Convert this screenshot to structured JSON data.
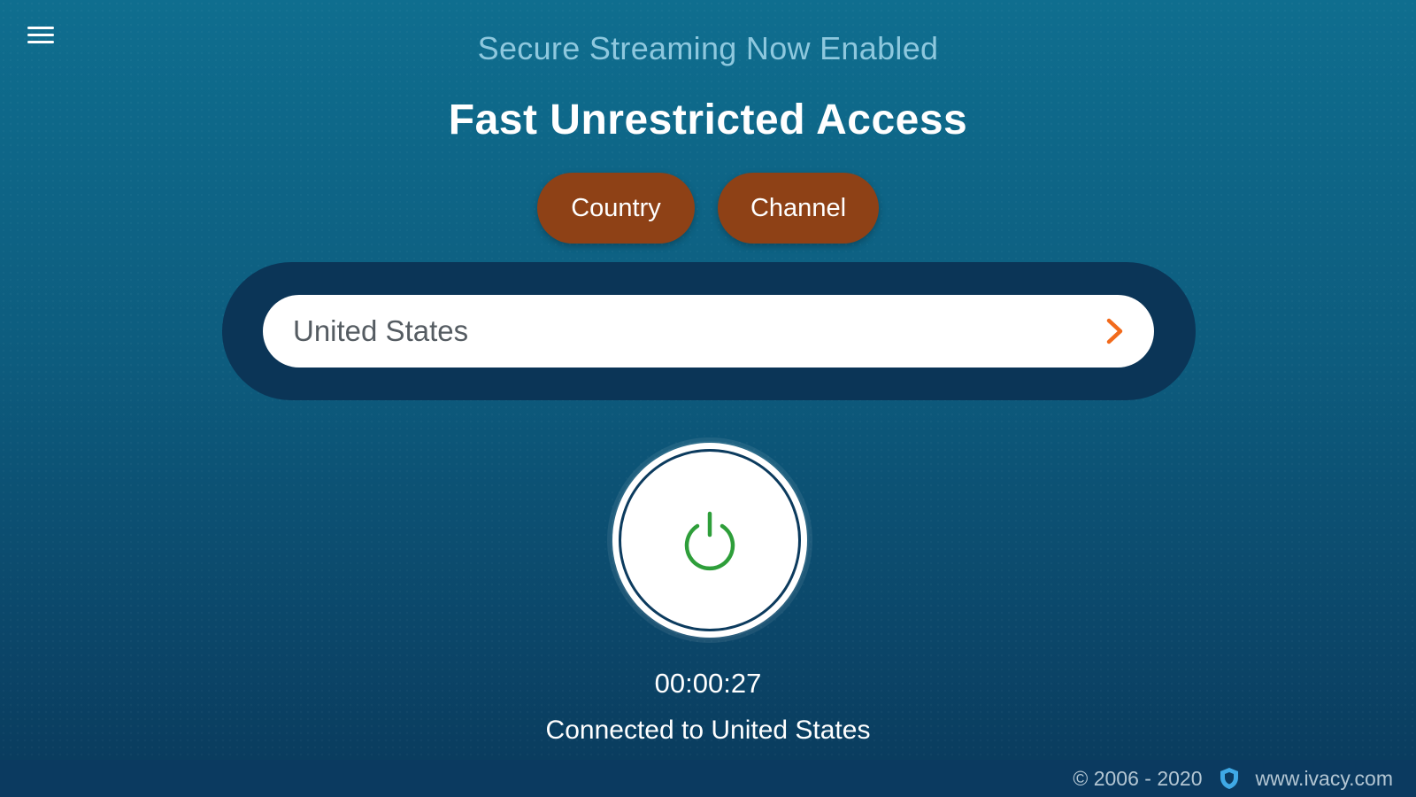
{
  "header": {
    "subtitle": "Secure Streaming Now Enabled",
    "title": "Fast Unrestricted Access"
  },
  "tabs": [
    {
      "label": "Country"
    },
    {
      "label": "Channel"
    }
  ],
  "location_selector": {
    "value": "United States"
  },
  "connection": {
    "timer": "00:00:27",
    "status": "Connected to United States"
  },
  "footer": {
    "copyright": "© 2006 - 2020",
    "website": "www.ivacy.com"
  },
  "icons": {
    "menu": "hamburger-menu-icon",
    "chevron": "chevron-right-icon",
    "power": "power-icon",
    "shield": "shield-icon"
  },
  "colors": {
    "tab_bg": "#8e4116",
    "power_green": "#2e9e3a",
    "chevron_orange": "#f26a1b",
    "shield_blue": "#3fa9e6"
  }
}
